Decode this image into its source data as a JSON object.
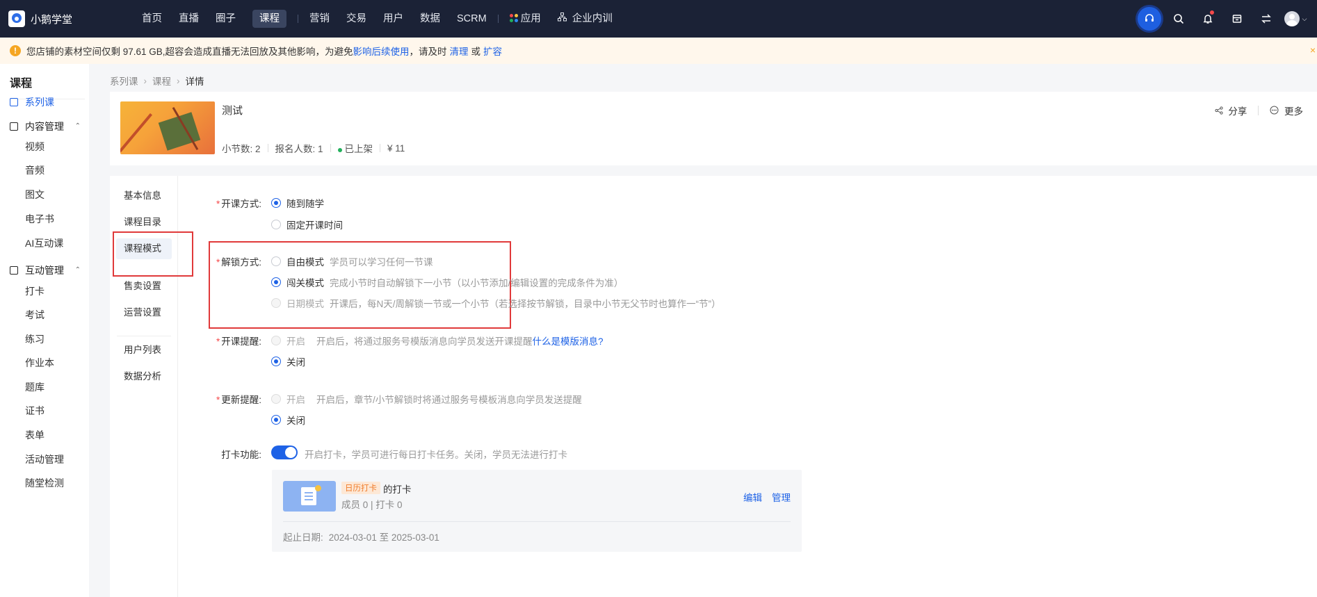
{
  "brand": {
    "name": "小鹅学堂"
  },
  "nav": {
    "items": [
      "首页",
      "直播",
      "圈子",
      "课程",
      "营销",
      "交易",
      "用户",
      "数据",
      "SCRM"
    ],
    "active": "课程",
    "app_label": "应用",
    "enterprise_label": "企业内训"
  },
  "notice": {
    "text_before": "您店铺的素材空间仅剩 97.61 GB,超容会造成直播无法回放及其他影响，为避免",
    "link1": "影响后续使用",
    "text_mid": "，请及时",
    "link2": "清理",
    "text_or": "或",
    "link3": "扩容",
    "close": "×"
  },
  "sidebar": {
    "title": "课程",
    "top_item": "系列课",
    "group1": {
      "label": "内容管理",
      "items": [
        "视频",
        "音频",
        "图文",
        "电子书",
        "AI互动课"
      ]
    },
    "group2": {
      "label": "互动管理",
      "items": [
        "打卡",
        "考试",
        "练习",
        "作业本",
        "题库",
        "证书",
        "表单",
        "活动管理",
        "随堂检测"
      ]
    }
  },
  "breadcrumb": {
    "items": [
      "系列课",
      "课程"
    ],
    "current": "详情"
  },
  "course": {
    "name": "测试",
    "lessons": "小节数: 2",
    "enrolled": "报名人数: 1",
    "status": "已上架",
    "price": "¥ 11",
    "share": "分享",
    "more": "更多"
  },
  "subnav": {
    "items": [
      "基本信息",
      "课程目录",
      "课程模式",
      "售卖设置",
      "运营设置"
    ],
    "items2": [
      "用户列表",
      "数据分析"
    ],
    "active": "课程模式"
  },
  "form": {
    "open_mode": {
      "label": "开课方式:",
      "options": [
        "随到随学",
        "固定开课时间"
      ]
    },
    "unlock_mode": {
      "label": "解锁方式:",
      "options": [
        {
          "name": "自由模式",
          "hint": "学员可以学习任何一节课"
        },
        {
          "name": "闯关模式",
          "hint": "完成小节时自动解锁下一小节（以小节添加/编辑设置的完成条件为准）"
        },
        {
          "name": "日期模式",
          "hint": "开课后，每N天/周解锁一节或一个小节（若选择按节解锁，目录中小节无父节时也算作一“节”）"
        }
      ]
    },
    "open_reminder": {
      "label": "开课提醒:",
      "on": "开启",
      "hint": "开启后，将通过服务号模版消息向学员发送开课提醒",
      "link": "什么是模版消息?",
      "off": "关闭"
    },
    "update_reminder": {
      "label": "更新提醒:",
      "on": "开启",
      "hint": "开启后，章节/小节解锁时将通过服务号模板消息向学员发送提醒",
      "off": "关闭"
    },
    "checkin": {
      "label": "打卡功能:",
      "hint": "开启打卡，学员可进行每日打卡任务。关闭，学员无法进行打卡"
    }
  },
  "checkin_card": {
    "tag": "日历打卡",
    "name": "的打卡",
    "stats": "成员 0 | 打卡 0",
    "edit": "编辑",
    "manage": "管理",
    "date_label": "起止日期:",
    "date_range": "2024-03-01 至 2025-03-01"
  },
  "colors": {
    "accent": "#1e62e6",
    "topbar": "#1b2236",
    "highlight": "#e0393a"
  }
}
